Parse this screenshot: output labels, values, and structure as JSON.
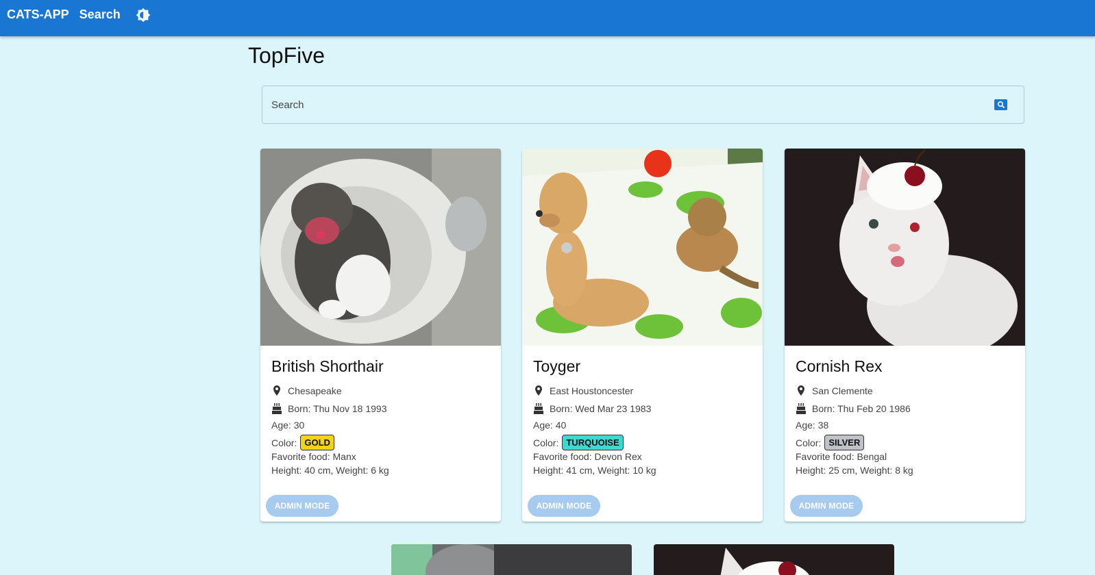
{
  "appbar": {
    "brand": "CATS-APP",
    "nav_search": "Search",
    "theme_icon": "brightness-icon",
    "color": "#1976d2"
  },
  "page": {
    "title": "TopFive"
  },
  "search": {
    "placeholder": "Search",
    "value": ""
  },
  "cards": [
    {
      "title": "British Shorthair",
      "location": "Chesapeake",
      "born": "Born: Thu Nov 18 1993",
      "age": "Age: 30",
      "color_label": "Color:",
      "color_value": "GOLD",
      "color_hex": "#f5d21a",
      "food": "Favorite food: Manx",
      "size": "Height: 40 cm, Weight: 6 kg",
      "button": "ADMIN MODE"
    },
    {
      "title": "Toyger",
      "location": "East Houstoncester",
      "born": "Born: Wed Mar 23 1983",
      "age": "Age: 40",
      "color_label": "Color:",
      "color_value": "TURQUOISE",
      "color_hex": "#3ed8d0",
      "food": "Favorite food: Devon Rex",
      "size": "Height: 41 cm, Weight: 10 kg",
      "button": "ADMIN MODE"
    },
    {
      "title": "Cornish Rex",
      "location": "San Clemente",
      "born": "Born: Thu Feb 20 1986",
      "age": "Age: 38",
      "color_label": "Color:",
      "color_value": "SILVER",
      "color_hex": "#bfc3c9",
      "food": "Favorite food: Bengal",
      "size": "Height: 25 cm, Weight: 8 kg",
      "button": "ADMIN MODE"
    }
  ]
}
